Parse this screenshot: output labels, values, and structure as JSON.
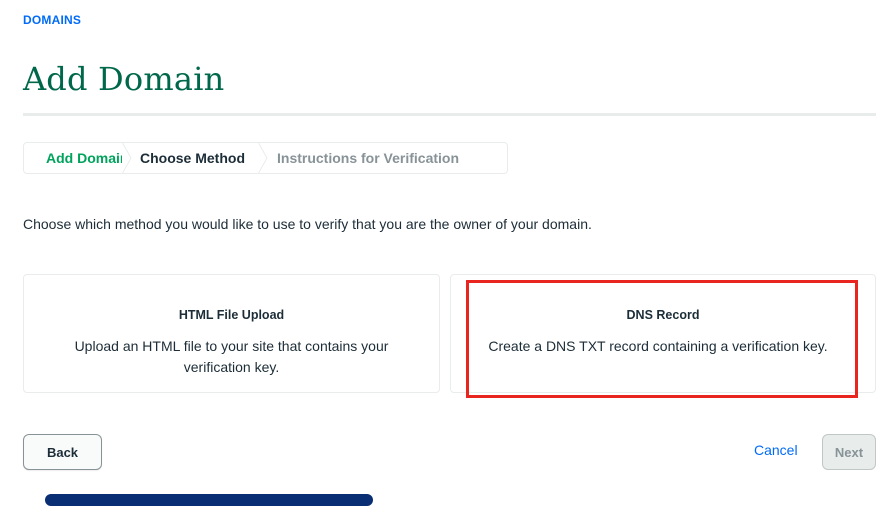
{
  "breadcrumb": {
    "label": "DOMAINS"
  },
  "page": {
    "title": "Add Domain"
  },
  "stepper": {
    "steps": [
      {
        "label": "Add Domain",
        "state": "complete"
      },
      {
        "label": "Choose Method",
        "state": "current"
      },
      {
        "label": "Instructions for Verification",
        "state": "upcoming"
      }
    ]
  },
  "intro": "Choose which method you would like to use to verify that you are the owner of your domain.",
  "methods": [
    {
      "title": "HTML File Upload",
      "description": "Upload an HTML file to your site that contains your verification key."
    },
    {
      "title": "DNS Record",
      "description": "Create a DNS TXT record containing a verification key."
    }
  ],
  "footer": {
    "back_label": "Back",
    "cancel_label": "Cancel",
    "next_label": "Next"
  },
  "colors": {
    "brand_green": "#00684a",
    "step_complete": "#00a35c",
    "link_blue": "#016bf8",
    "highlight_red": "#e8251f"
  },
  "icons": {
    "step_complete": "check-icon",
    "step_separator": "chevron-right-icon"
  }
}
